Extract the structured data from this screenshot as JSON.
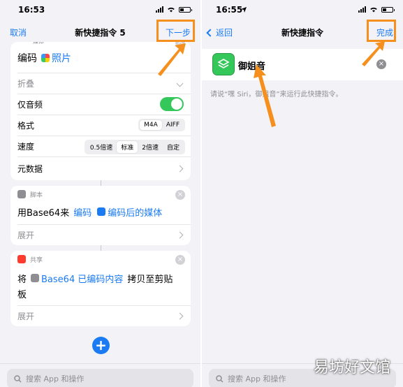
{
  "left": {
    "status_time": "16:53",
    "nav": {
      "cancel": "取消",
      "title": "新快捷指令 5",
      "next": "下一步"
    },
    "encode_card": {
      "category": "媒体",
      "action_prefix": "编码",
      "action_param": "照片",
      "collapse": "折叠",
      "audio_only_label": "仅音频",
      "audio_only_value": true,
      "format_label": "格式",
      "format_options": [
        "M4A",
        "AIFF"
      ],
      "format_selected": "M4A",
      "speed_label": "速度",
      "speed_options": [
        "0.5倍速",
        "标准",
        "2倍速",
        "自定"
      ],
      "speed_selected": "标准",
      "metadata_label": "元数据"
    },
    "base64_card": {
      "category": "脚本",
      "action_prefix": "用Base64来",
      "action_mode": "编码",
      "action_input": "编码后的媒体",
      "expand": "展开"
    },
    "share_card": {
      "category": "共享",
      "action_prefix": "将",
      "action_input": "Base64 已编码内容",
      "action_suffix": "拷贝至剪贴",
      "action_suffix2": "板",
      "expand": "展开"
    },
    "search_placeholder": "搜索 App 和操作"
  },
  "right": {
    "status_time": "16:55",
    "nav": {
      "back": "返回",
      "title": "新快捷指令",
      "done": "完成"
    },
    "shortcut_name": "御姐音",
    "siri_hint": "请说“嘿 Siri，御姐音”来运行此快捷指令。",
    "search_placeholder": "搜索 App 和操作"
  },
  "watermark": "易坊好文馆",
  "colors": {
    "accent": "#1a7bf2",
    "highlight": "#f5901f",
    "toggle_on": "#34c759",
    "shortcut_icon": "#34c759"
  }
}
